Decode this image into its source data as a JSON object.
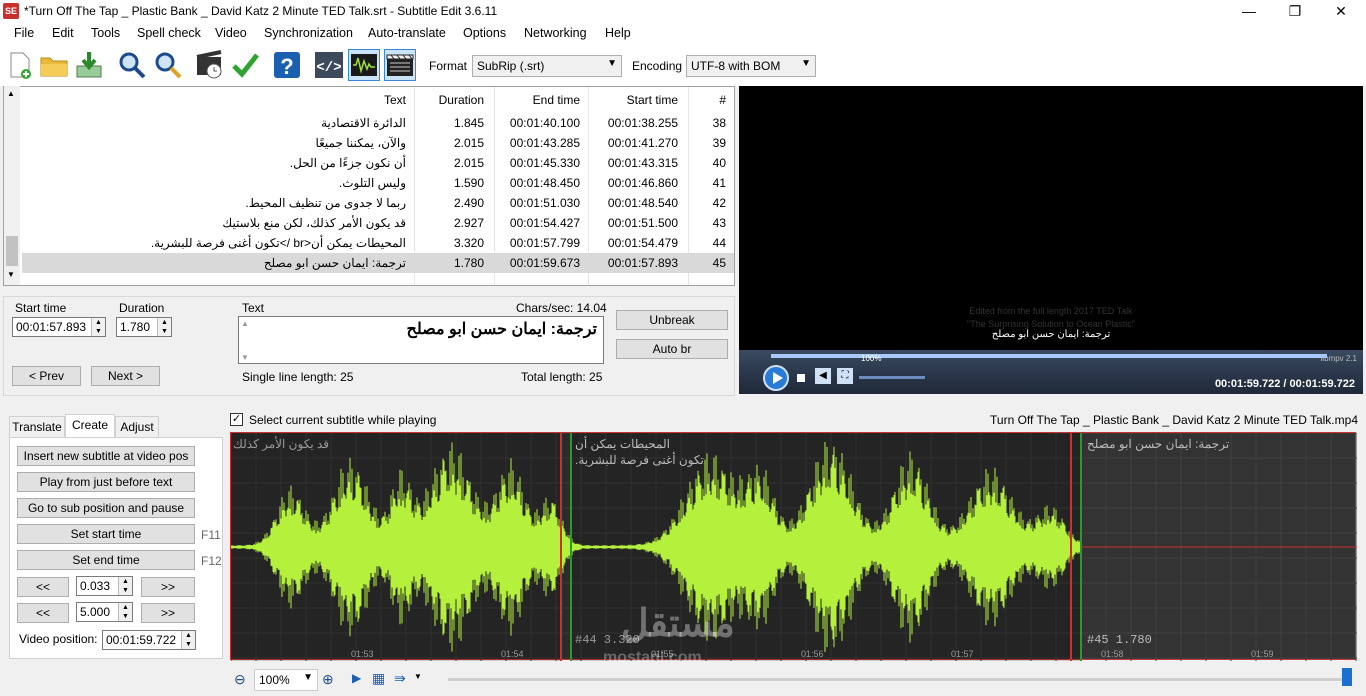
{
  "window": {
    "title": "*Turn Off The Tap  _ Plastic Bank _ David Katz 2 Minute TED Talk.srt - Subtitle Edit 3.6.11",
    "app_icon_text": "SE",
    "minimize": "—",
    "maximize": "❐",
    "close": "✕"
  },
  "menu": [
    "File",
    "Edit",
    "Tools",
    "Spell check",
    "Video",
    "Synchronization",
    "Auto-translate",
    "Options",
    "Networking",
    "Help"
  ],
  "toolbar": {
    "format_label": "Format",
    "format_value": "SubRip (.srt)",
    "encoding_label": "Encoding",
    "encoding_value": "UTF-8 with BOM",
    "icons": [
      "new-file-icon",
      "open-folder-icon",
      "download-icon",
      "find-icon",
      "replace-icon",
      "sync-icon",
      "check-icon",
      "help-icon",
      "source-view-icon",
      "waveform-toggle-icon",
      "video-toggle-icon"
    ]
  },
  "grid": {
    "headers": {
      "text": "Text",
      "duration": "Duration",
      "end": "End time",
      "start": "Start time",
      "num": "#"
    },
    "rows": [
      {
        "num": "38",
        "start": "00:01:38.255",
        "end": "00:01:40.100",
        "duration": "1.845",
        "text": "الدائرة الاقتصادية"
      },
      {
        "num": "39",
        "start": "00:01:41.270",
        "end": "00:01:43.285",
        "duration": "2.015",
        "text": "والآن، يمكننا جميعًا"
      },
      {
        "num": "40",
        "start": "00:01:43.315",
        "end": "00:01:45.330",
        "duration": "2.015",
        "text": "أن نكون جزءًا من الحل."
      },
      {
        "num": "41",
        "start": "00:01:46.860",
        "end": "00:01:48.450",
        "duration": "1.590",
        "text": "وليس التلوث."
      },
      {
        "num": "42",
        "start": "00:01:48.540",
        "end": "00:01:51.030",
        "duration": "2.490",
        "text": "ربما لا جدوى من تنظيف المحيط."
      },
      {
        "num": "43",
        "start": "00:01:51.500",
        "end": "00:01:54.427",
        "duration": "2.927",
        "text": "قد يكون الأمر كذلك، لكن منع بلاستيك"
      },
      {
        "num": "44",
        "start": "00:01:54.479",
        "end": "00:01:57.799",
        "duration": "3.320",
        "text": "المحيطات يمكن أن<br />تكون أغنى فرصة للبشرية."
      },
      {
        "num": "45",
        "start": "00:01:57.893",
        "end": "00:01:59.673",
        "duration": "1.780",
        "text": "ترجمة: ايمان حسن ابو مصلح"
      }
    ]
  },
  "editor": {
    "start_time_label": "Start time",
    "start_time_value": "00:01:57.893",
    "duration_label": "Duration",
    "duration_value": "1.780",
    "text_label": "Text",
    "chars_sec": "Chars/sec: 14.04",
    "text_value": "ترجمة: ايمان حسن ابو مصلح",
    "single_line": "Single line length: 25",
    "total_length": "Total length: 25",
    "prev": "< Prev",
    "next": "Next >",
    "unbreak": "Unbreak",
    "auto_br": "Auto br"
  },
  "video": {
    "overlay_faint_1": "Edited from the full length 2017 TED Talk",
    "overlay_faint_2": "\"The Surprising Solution to Ocean Plastic\"",
    "subtitle": "ترجمة: ايمان حسن ابو مصلح",
    "volume": "100%",
    "engine": "libmpv 2.1",
    "position": "00:01:59.722 / 00:01:59.722",
    "progress": 1.0
  },
  "bottom": {
    "select_while_playing": "Select current subtitle while playing",
    "video_file": "Turn Off The Tap  _ Plastic Bank _ David Katz 2 Minute TED Talk.mp4",
    "tabs": [
      "Translate",
      "Create",
      "Adjust"
    ],
    "insert": "Insert new subtitle at video pos",
    "play_before": "Play from just before text",
    "goto_sub": "Go to sub position and pause",
    "set_start": "Set start time",
    "set_start_key": "F11",
    "set_end": "Set end time",
    "set_end_key": "F12",
    "back": "<<",
    "fwd": ">>",
    "step_small": "0.033",
    "step_large": "5.000",
    "video_pos_label": "Video position:",
    "video_pos_value": "00:01:59.722"
  },
  "waveform": {
    "labels": [
      {
        "text": "قد يكون الأمر كذلك"
      },
      {
        "text": "المحيطات يمكن أن"
      },
      {
        "text": "تكون أغنى فرصة للبشرية."
      },
      {
        "text": "ترجمة: ايمان حسن ابو مصلح"
      }
    ],
    "seg44": "#44  3.320",
    "seg45": "#45  1.780",
    "ticks": [
      "01:53",
      "01:54",
      "01:55",
      "01:56",
      "01:57",
      "01:58",
      "01:59"
    ],
    "zoom": "100%",
    "watermark_ar": "مستقل",
    "watermark": "mostaql.com"
  }
}
